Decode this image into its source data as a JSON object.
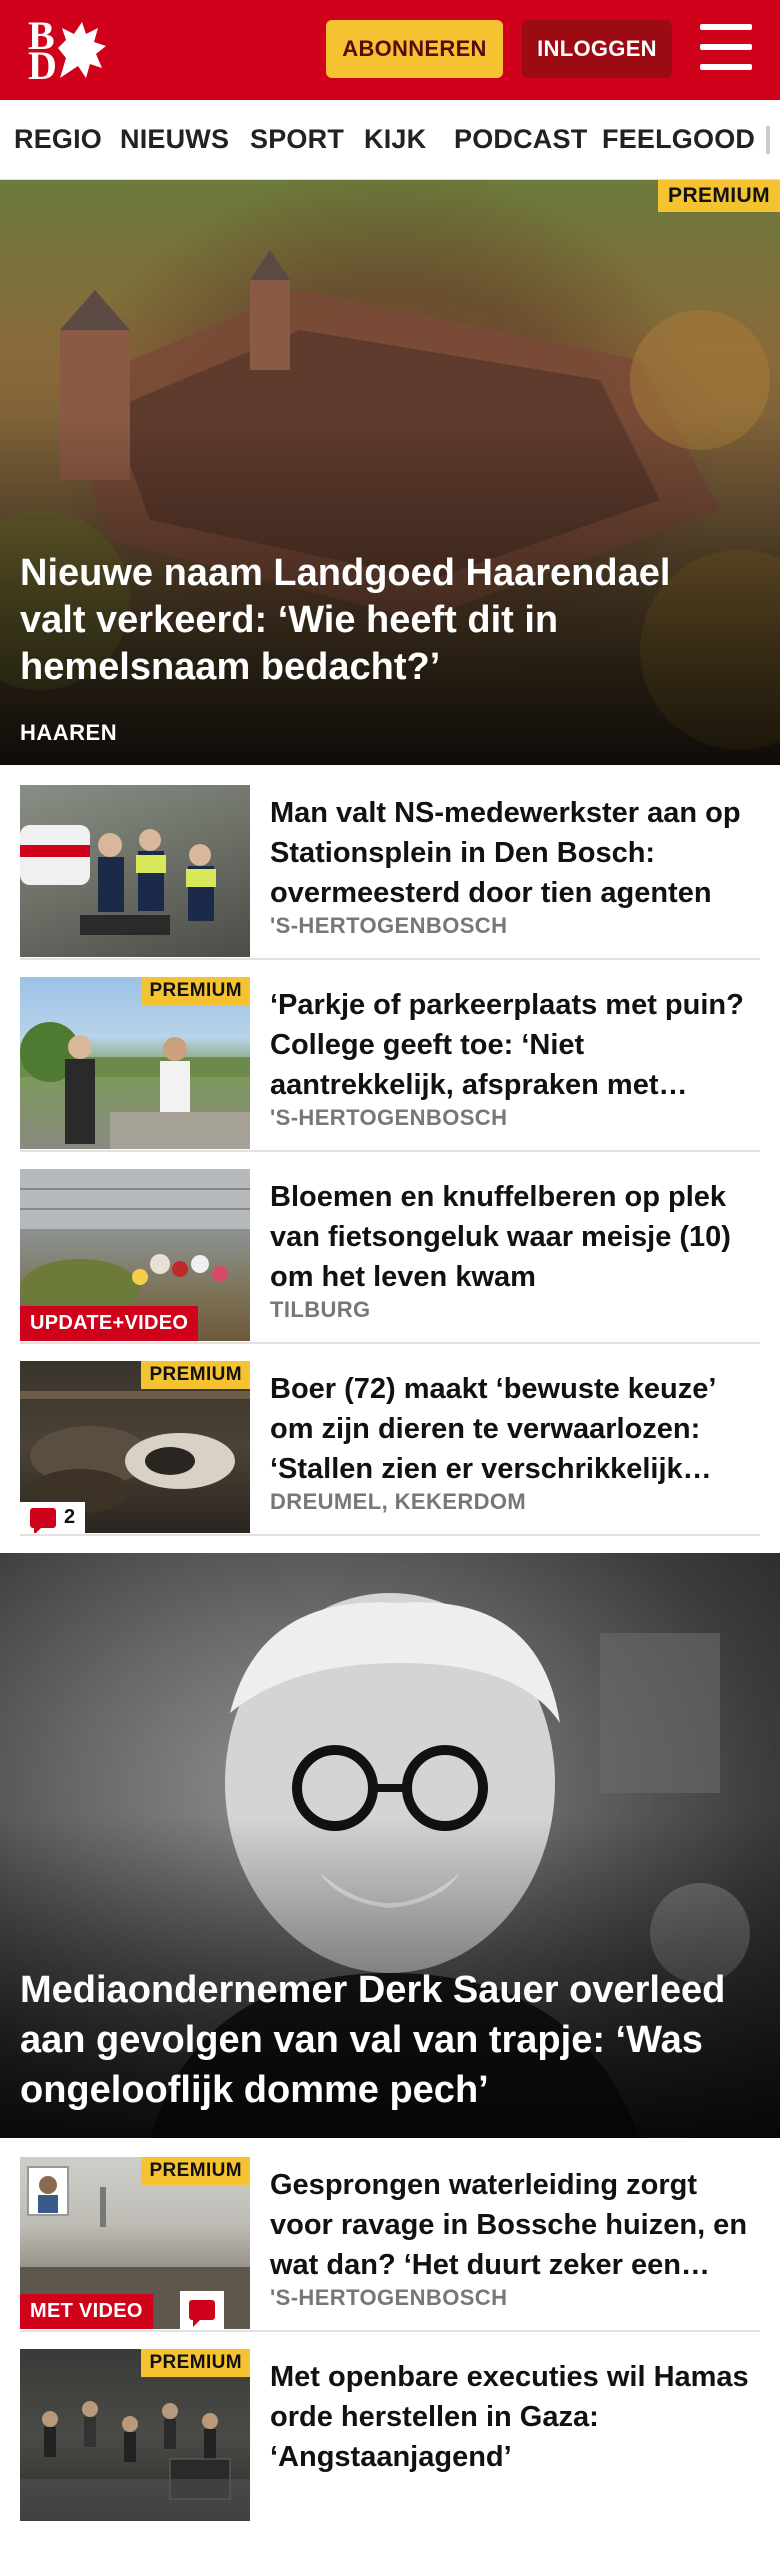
{
  "header": {
    "logo_letters": [
      "B",
      "D"
    ],
    "subscribe_label": "ABONNEREN",
    "login_label": "INLOGGEN",
    "colors": {
      "brand": "#d0021b",
      "accent": "#f5c332",
      "login_bg": "#9c0a14"
    }
  },
  "nav": {
    "items": [
      {
        "label": "REGIO"
      },
      {
        "label": "NIEUWS"
      },
      {
        "label": "SPORT"
      },
      {
        "label": "KIJK"
      },
      {
        "label": "PODCAST"
      },
      {
        "label": "FEELGOOD"
      }
    ]
  },
  "hero": {
    "badge": "PREMIUM",
    "title": "Nieuwe naam Landgoed Haarendael valt verkeerd: ‘Wie heeft dit in hemelsnaam bedacht?’",
    "location": "HAAREN"
  },
  "articles": [
    {
      "title": "Man valt NS-medewerkster aan op Stationsplein in Den Bosch: overmeesterd door tien agenten",
      "location": "'S-HERTOGENBOSCH"
    },
    {
      "badge": "PREMIUM",
      "title": "‘Parkje of parkeerplaats met puin? College geeft toe: ‘Niet aantrekkelijk, afspraken met…",
      "location": "'S-HERTOGENBOSCH"
    },
    {
      "label": "UPDATE+VIDEO",
      "title": "Bloemen en knuffelberen op plek van fietsongeluk waar meisje (10) om het leven kwam",
      "location": "TILBURG"
    },
    {
      "badge": "PREMIUM",
      "comments": "2",
      "title": "Boer (72) maakt ‘bewuste keuze’ om zijn dieren te verwaarlozen: ‘Stallen zien er verschrikkelijk…",
      "location": "DREUMEL, KEKERDOM"
    }
  ],
  "hero2": {
    "title": "Mediaondernemer Derk Sauer overleed aan gevolgen van val van trapje: ‘Was ongelooflijk domme pech’"
  },
  "articles2": [
    {
      "badge": "PREMIUM",
      "label": "MET VIDEO",
      "title": "Gesprongen waterleiding zorgt voor ravage in Bossche huizen, en wat dan? ‘Het duurt zeker een…",
      "location": "'S-HERTOGENBOSCH"
    },
    {
      "badge": "PREMIUM",
      "title": "Met openbare executies wil Hamas orde herstellen in Gaza: ‘Angstaanjagend’"
    }
  ]
}
